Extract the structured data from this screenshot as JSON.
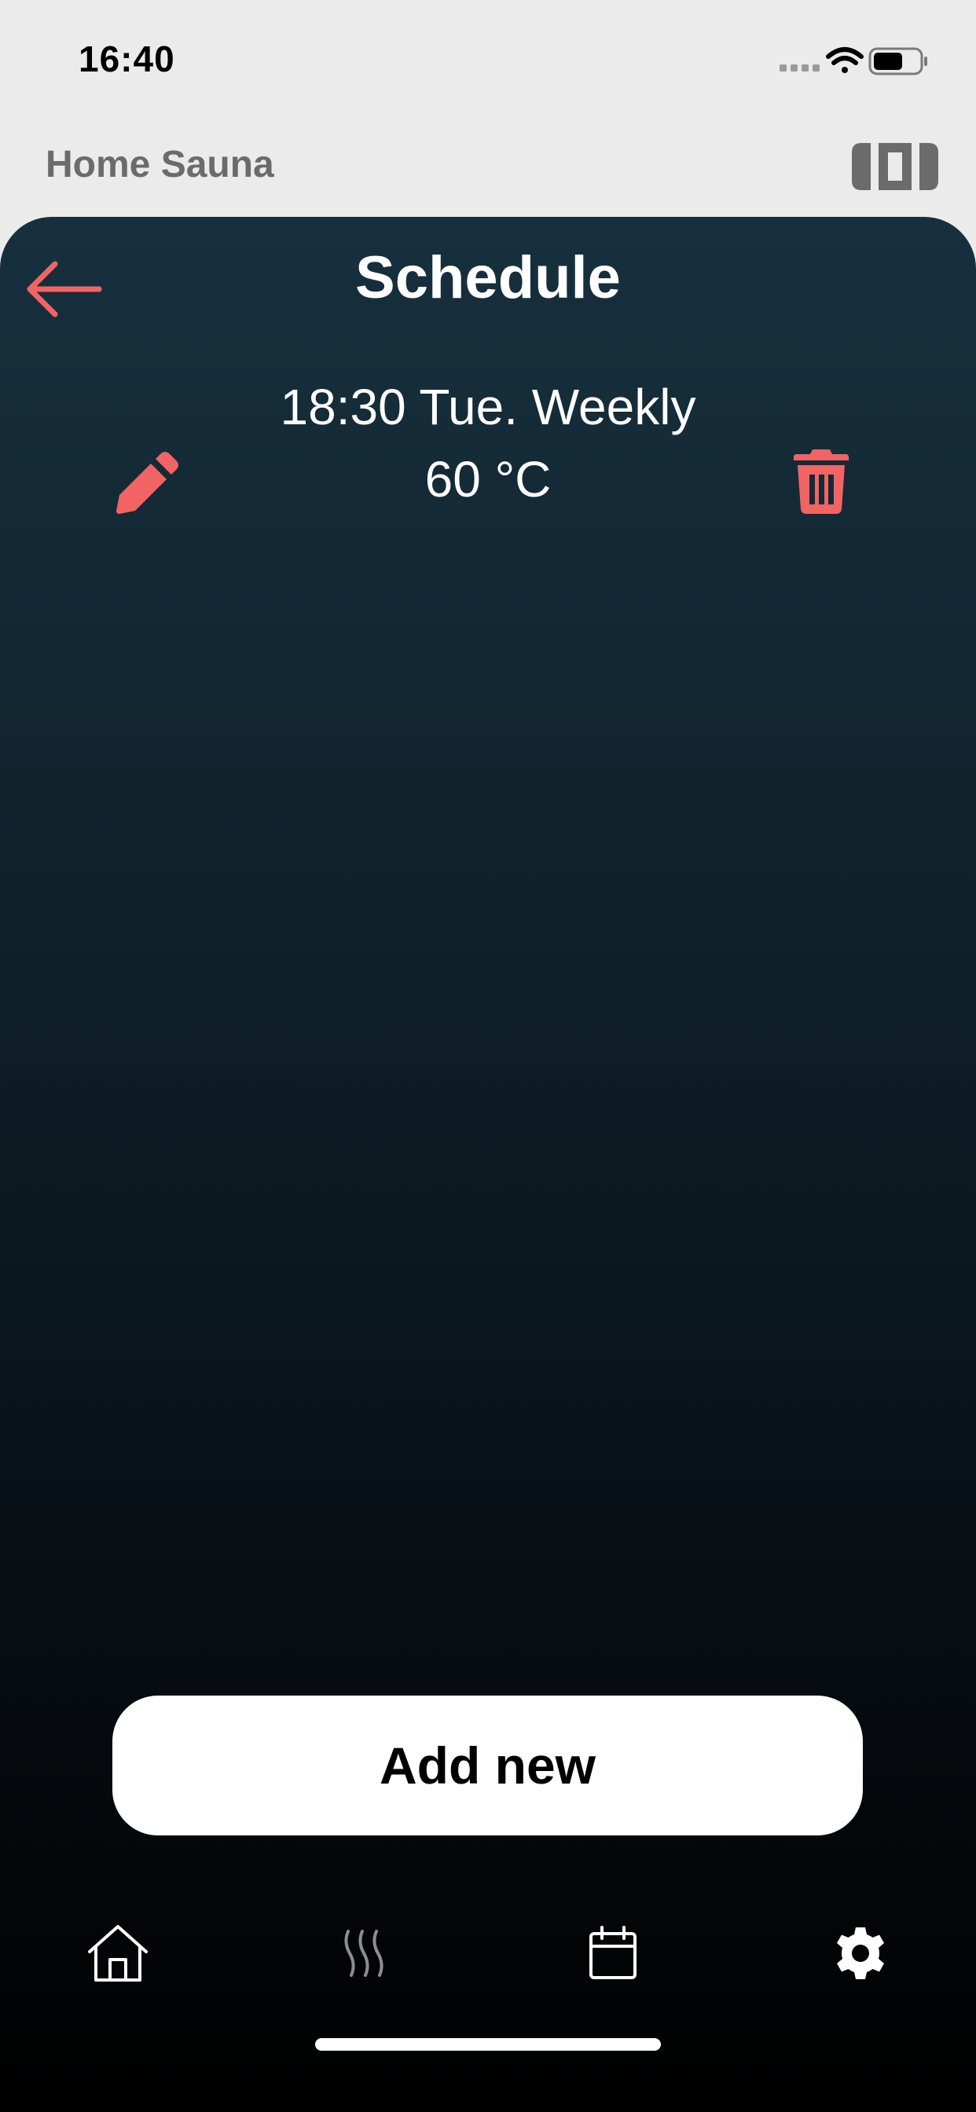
{
  "status_bar": {
    "time": "16:40",
    "icons": [
      "signal-icon",
      "wifi-icon",
      "battery-icon"
    ]
  },
  "header": {
    "app_title": "Home Sauna",
    "icon": "sauna-device-icon"
  },
  "screen": {
    "title": "Schedule",
    "schedule_items": [
      {
        "time_line": "18:30 Tue. Weekly",
        "temp_line": "60 °C"
      }
    ],
    "add_button_label": "Add new"
  },
  "tab_bar": {
    "tabs": [
      {
        "icon": "home-icon",
        "active": true
      },
      {
        "icon": "heat-waves-icon",
        "active": false
      },
      {
        "icon": "calendar-icon",
        "active": true
      },
      {
        "icon": "gear-icon",
        "active": true
      }
    ]
  },
  "colors": {
    "accent": "#f26464",
    "header_text": "#6b6b6b",
    "background_top": "#17303e",
    "background_bottom": "#000000"
  }
}
